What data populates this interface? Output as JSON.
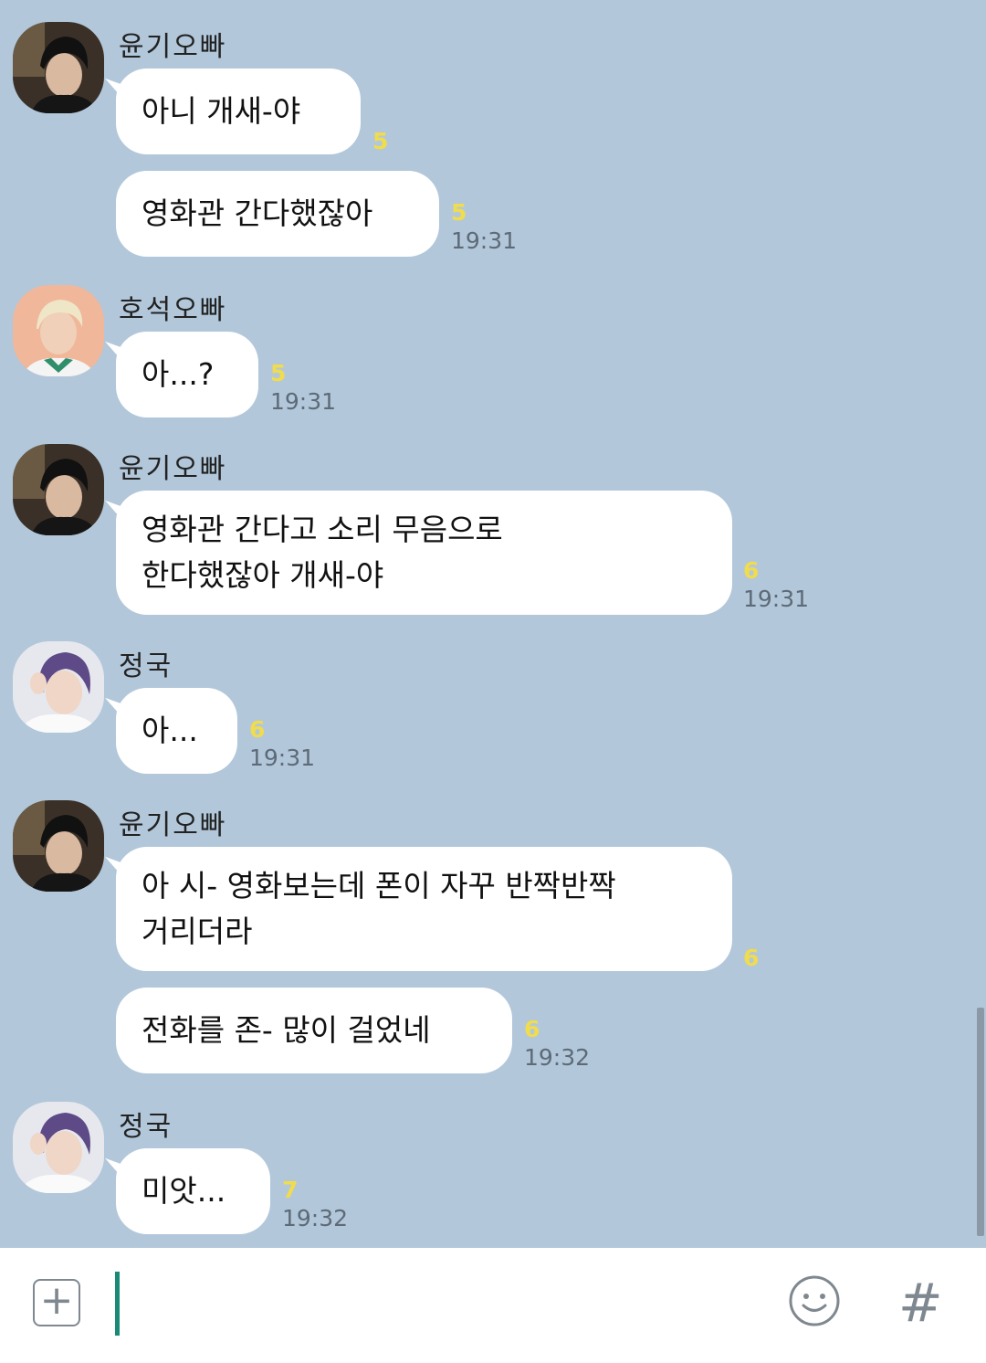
{
  "messages": [
    {
      "sender": "윤기오빠",
      "avatar": "yoongi",
      "show_header": true,
      "text": "아니 개새-야",
      "unread": "5",
      "time": ""
    },
    {
      "sender": "윤기오빠",
      "avatar": "yoongi",
      "show_header": false,
      "text": "영화관 간다했잖아",
      "unread": "5",
      "time": "19:31"
    },
    {
      "sender": "호석오빠",
      "avatar": "hoseok",
      "show_header": true,
      "text": "아...?",
      "unread": "5",
      "time": "19:31"
    },
    {
      "sender": "윤기오빠",
      "avatar": "yoongi",
      "show_header": true,
      "text": "영화관 간다고 소리 무음으로\n한다했잖아 개새-야",
      "unread": "6",
      "time": "19:31"
    },
    {
      "sender": "정국",
      "avatar": "jungkook",
      "show_header": true,
      "text": "아...",
      "unread": "6",
      "time": "19:31"
    },
    {
      "sender": "윤기오빠",
      "avatar": "yoongi",
      "show_header": true,
      "text": "아 시- 영화보는데 폰이 자꾸 반짝반짝\n거리더라",
      "unread": "6",
      "time": ""
    },
    {
      "sender": "윤기오빠",
      "avatar": "yoongi",
      "show_header": false,
      "text": "전화를 존- 많이 걸었네",
      "unread": "6",
      "time": "19:32"
    },
    {
      "sender": "정국",
      "avatar": "jungkook",
      "show_header": true,
      "text": "미앗...",
      "unread": "7",
      "time": "19:32"
    }
  ],
  "input": {
    "plus_icon": "plus-square-icon",
    "emoji_icon": "smiley-icon",
    "hash_icon": "hashtag-icon",
    "hash_label": "#",
    "plus_label": "+"
  },
  "colors": {
    "background": "#b2c7da",
    "bubble": "#ffffff",
    "unread": "#f1dc4c",
    "cursor": "#1a8a78"
  }
}
